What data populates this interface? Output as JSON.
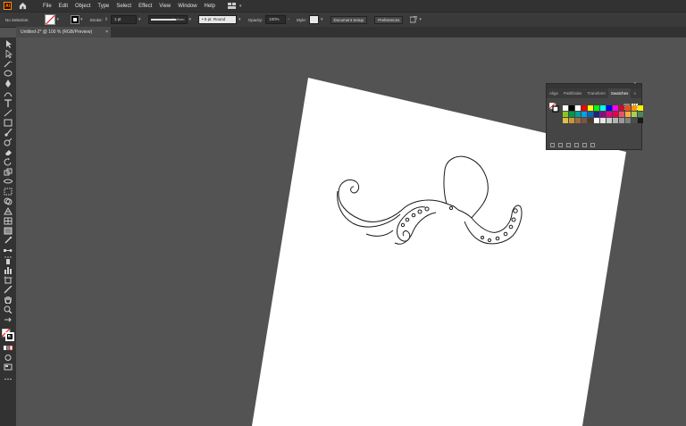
{
  "app": {
    "logo": "Ai"
  },
  "menu": [
    "File",
    "Edit",
    "Object",
    "Type",
    "Select",
    "Effect",
    "View",
    "Window",
    "Help"
  ],
  "control": {
    "selection": "No Selection",
    "stroke_label": "Stroke:",
    "stroke_weight": "1 pt",
    "profile": "Uniform",
    "brush": "5 pt. Round",
    "opacity_label": "Opacity:",
    "opacity_value": "100%",
    "style_label": "Style:",
    "doc_setup": "Document Setup",
    "preferences": "Preferences"
  },
  "document_tab": {
    "title": "Untitled-2* @ 100 % (RGB/Preview)",
    "close": "×"
  },
  "panel": {
    "tabs": [
      "Align",
      "Pathfinder",
      "Transform",
      "Swatches"
    ],
    "active_tab": "Swatches",
    "collapse": "«",
    "close": "×",
    "menu": "≡"
  },
  "swatches": [
    [
      "#ffffff",
      "#000000",
      "#ffffff",
      "#ff0000",
      "#ffff00",
      "#00ff00",
      "#00ffff",
      "#0000ff",
      "#ff00ff",
      "#c8102e",
      "#e3541c",
      "#f39800",
      "#fff100"
    ],
    [
      "#8fc31f",
      "#009944",
      "#009e96",
      "#00a0e9",
      "#0068b7",
      "#1d2088",
      "#920783",
      "#e4007f",
      "#e5004f",
      "#e95464",
      "#f6ad3c",
      "#aacf53",
      "#47885e"
    ],
    [
      "#d7c447",
      "#c89932",
      "#9c6e3c",
      "#7b5544",
      "#4b3d2a",
      "#ffffff",
      "#e6e6e6",
      "#cccccc",
      "#b3b3b3",
      "#999999",
      "#808080",
      "#4d4d4d",
      "#1a1a1a"
    ]
  ]
}
